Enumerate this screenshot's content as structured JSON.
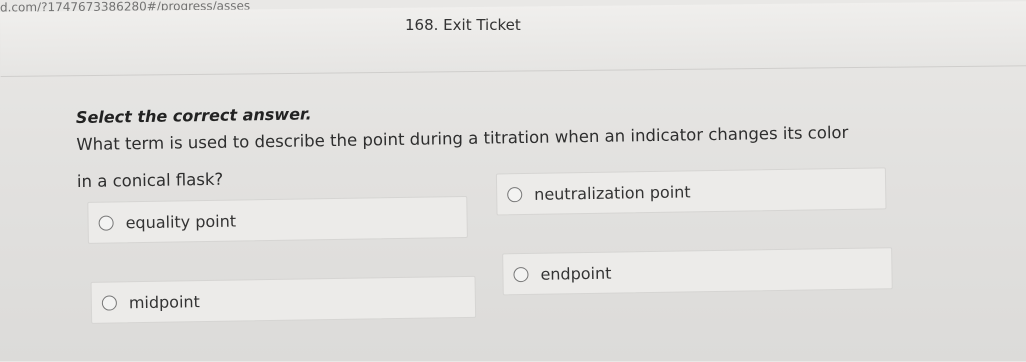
{
  "browser": {
    "url": "d.com/?1747673386280#/progress/asses"
  },
  "header": {
    "title": "168. Exit Ticket"
  },
  "question": {
    "instruction": "Select the correct answer.",
    "text": "What term is used to describe the point during a titration when an indicator changes its color in a conical flask?"
  },
  "options": [
    {
      "label": "equality point",
      "selected": false
    },
    {
      "label": "neutralization point",
      "selected": false
    },
    {
      "label": "midpoint",
      "selected": false
    },
    {
      "label": "endpoint",
      "selected": false
    }
  ]
}
